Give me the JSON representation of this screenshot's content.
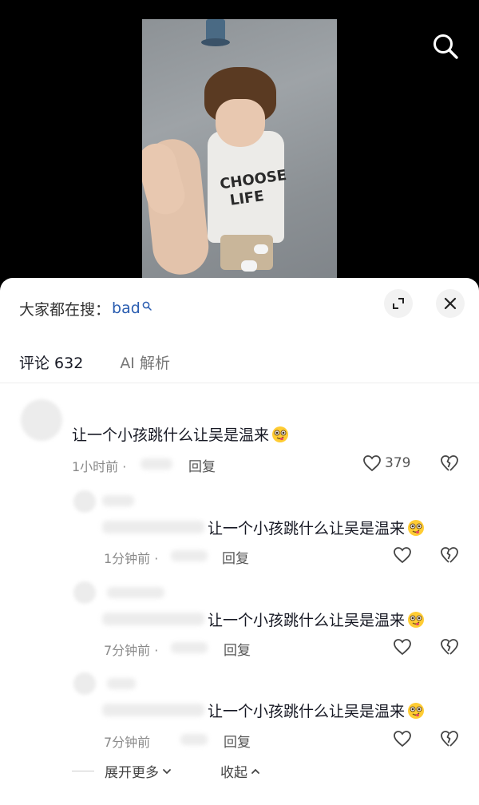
{
  "sheet": {
    "search_prefix": "大家都在搜：",
    "search_keyword": "bad",
    "tabs": [
      {
        "label": "评论 632",
        "active": true
      },
      {
        "label": "AI 解析",
        "active": false
      }
    ]
  },
  "comments": [
    {
      "text": "让一个小孩跳什么让吴是温来",
      "time": "1小时前 ·",
      "reply_label": "回复",
      "likes": "379"
    },
    {
      "text": "让一个小孩跳什么让吴是温来",
      "time": "1分钟前 ·",
      "reply_label": "回复"
    },
    {
      "text": "让一个小孩跳什么让吴是温来",
      "time": "7分钟前 ·",
      "reply_label": "回复"
    },
    {
      "text": "让一个小孩跳什么让吴是温来",
      "time": "7分钟前",
      "reply_label": "回复"
    }
  ],
  "footer": {
    "expand_more": "展开更多",
    "collapse": "收起"
  },
  "video": {
    "shirt_print": "CHOOSE LIFE"
  },
  "colors": {
    "keyword": "#2a5db0",
    "sheet_bg": "#ffffff",
    "video_bg": "#000000"
  },
  "icons": [
    "search-icon",
    "expand-icon",
    "close-icon",
    "heart-icon",
    "broken-heart-icon",
    "chevron-down-icon",
    "chevron-up-icon",
    "drooling-face-emoji"
  ]
}
